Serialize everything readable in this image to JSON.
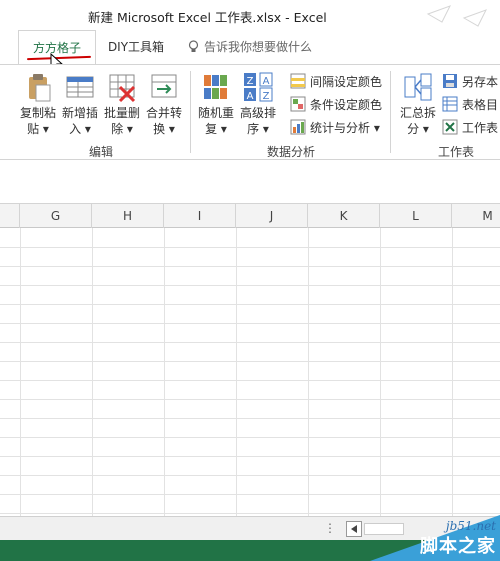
{
  "window": {
    "title": "新建 Microsoft Excel 工作表.xlsx - Excel"
  },
  "tabs": {
    "active": "方方格子",
    "diy": "DIY工具箱",
    "tell_me_placeholder": "告诉我你想要做什么"
  },
  "ribbon": {
    "edit_group": {
      "label": "编辑",
      "buttons": [
        {
          "line1": "复制粘",
          "line2": "贴 ▾",
          "icon": "paste-icon"
        },
        {
          "line1": "新增插",
          "line2": "入 ▾",
          "icon": "insert-icon"
        },
        {
          "line1": "批量删",
          "line2": "除 ▾",
          "icon": "batch-delete-icon"
        },
        {
          "line1": "合并转",
          "line2": "换 ▾",
          "icon": "merge-convert-icon"
        }
      ]
    },
    "data_group": {
      "label": "数据分析",
      "buttons": [
        {
          "line1": "随机重",
          "line2": "复 ▾",
          "icon": "random-icon"
        },
        {
          "line1": "高级排",
          "line2": "序 ▾",
          "icon": "sort-az-icon"
        }
      ],
      "small_buttons": [
        {
          "label": "间隔设定颜色",
          "icon": "interval-color-icon"
        },
        {
          "label": "条件设定颜色",
          "icon": "condition-color-icon"
        },
        {
          "label": "统计与分析 ▾",
          "icon": "stats-icon"
        }
      ]
    },
    "worksheet_group": {
      "label": "工作表",
      "buttons": [
        {
          "line1": "汇总拆",
          "line2": "分 ▾",
          "icon": "summary-split-icon"
        }
      ],
      "small_buttons": [
        {
          "label": "另存本",
          "icon": "save-as-icon"
        },
        {
          "label": "表格目",
          "icon": "table-dir-icon"
        },
        {
          "label": "工作表",
          "icon": "worksheet-icon"
        }
      ]
    }
  },
  "grid": {
    "columns": [
      "G",
      "H",
      "I",
      "J",
      "K",
      "L",
      "M"
    ]
  },
  "sheet_bar": {
    "dots": "⋮"
  },
  "watermark": {
    "url": "jb51.net",
    "name": "脚本之家"
  },
  "colors": {
    "excel_green": "#217346",
    "annotation_red": "#cc0000"
  }
}
